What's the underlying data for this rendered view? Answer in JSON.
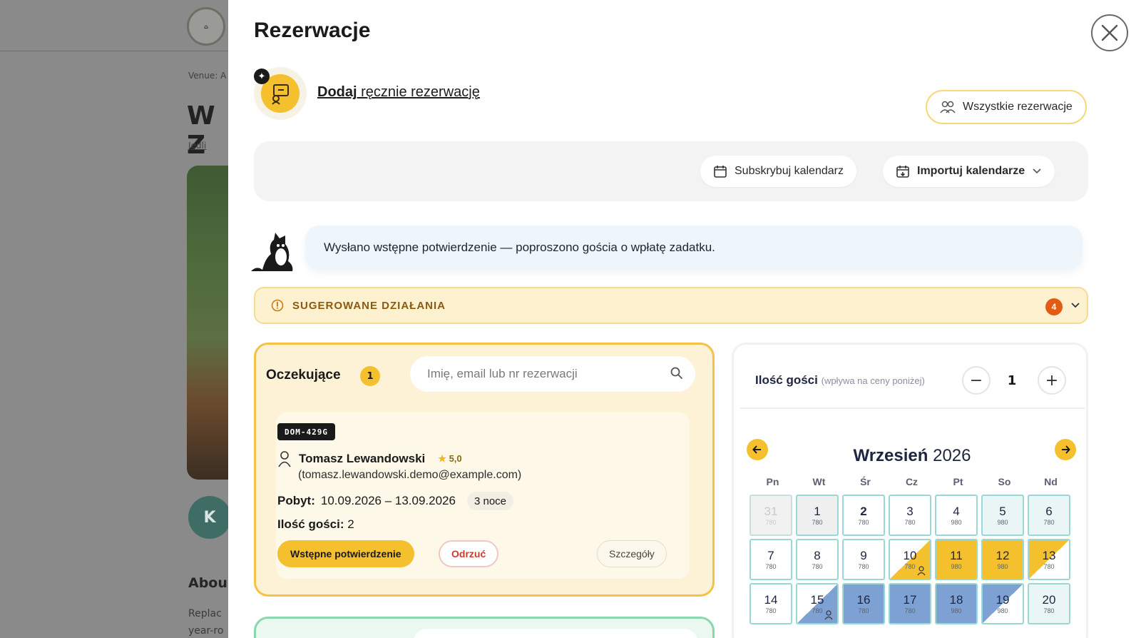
{
  "background": {
    "logo_text": "DOM\nLAS",
    "venue_label": "Venue: A",
    "title_fragment": "W Z",
    "location": "Jedli",
    "avatar_initial": "K",
    "about": "Abou",
    "replace_text_1": "Replac",
    "replace_text_2": "year-ro"
  },
  "drawer": {
    "title": "Rezerwacje",
    "add_link_bold": "Dodaj",
    "add_link_rest": " ręcznie rezerwację",
    "all_reservations": "Wszystkie rezerwacje",
    "subscribe_calendar": "Subskrybuj kalendarz",
    "import_calendars": "Importuj kalendarze",
    "info_message": "Wysłano wstępne potwierdzenie — poproszono gościa o wpłatę zadatku.",
    "suggested_actions": "SUGEROWANE DZIAŁANIA",
    "suggested_count": "4"
  },
  "pending": {
    "title": "Oczekujące",
    "count": "1",
    "search_placeholder": "Imię, email lub nr rezerwacji",
    "reservation": {
      "code": "DOM-429G",
      "guest_name": "Tomasz Lewandowski",
      "rating": "5,0",
      "email": "(tomasz.lewandowski.demo@example.com)",
      "stay_label": "Pobyt:",
      "stay_dates": "10.09.2026 – 13.09.2026",
      "nights": "3 noce",
      "guests_label": "Ilość gości:",
      "guests_value": "2",
      "confirm_button": "Wstępne potwierdzenie",
      "reject_button": "Odrzuć",
      "details_button": "Szczegóły"
    }
  },
  "calendar": {
    "guests_label": "Ilość gości",
    "guests_hint": "(wpływa na ceny poniżej)",
    "guests_value": "1",
    "month": "Wrzesień",
    "year": "2026",
    "weekdays": [
      "Pn",
      "Wt",
      "Śr",
      "Cz",
      "Pt",
      "So",
      "Nd"
    ],
    "days": [
      {
        "n": "31",
        "p": "780",
        "state": "past"
      },
      {
        "n": "1",
        "p": "780",
        "state": "gray"
      },
      {
        "n": "2",
        "p": "780",
        "state": "white",
        "bold": true
      },
      {
        "n": "3",
        "p": "780",
        "state": "white"
      },
      {
        "n": "4",
        "p": "980",
        "state": "white"
      },
      {
        "n": "5",
        "p": "980",
        "state": "teal"
      },
      {
        "n": "6",
        "p": "780",
        "state": "teal"
      },
      {
        "n": "7",
        "p": "780",
        "state": "white"
      },
      {
        "n": "8",
        "p": "780",
        "state": "white"
      },
      {
        "n": "9",
        "p": "780",
        "state": "white"
      },
      {
        "n": "10",
        "p": "780",
        "state": "half-yellow-start",
        "person": true
      },
      {
        "n": "11",
        "p": "980",
        "state": "yellow"
      },
      {
        "n": "12",
        "p": "980",
        "state": "yellow"
      },
      {
        "n": "13",
        "p": "780",
        "state": "half-yellow-end"
      },
      {
        "n": "14",
        "p": "780",
        "state": "white"
      },
      {
        "n": "15",
        "p": "780",
        "state": "half-blue-start",
        "person": true
      },
      {
        "n": "16",
        "p": "780",
        "state": "blue"
      },
      {
        "n": "17",
        "p": "780",
        "state": "blue"
      },
      {
        "n": "18",
        "p": "980",
        "state": "blue"
      },
      {
        "n": "19",
        "p": "980",
        "state": "half-blue-end"
      },
      {
        "n": "20",
        "p": "780",
        "state": "teal"
      }
    ]
  },
  "colors": {
    "accent_yellow": "#f5c02e",
    "booked_blue": "#7ea1d4",
    "cell_border_teal": "#9ad8d6",
    "reject_red": "#c93b2e"
  }
}
